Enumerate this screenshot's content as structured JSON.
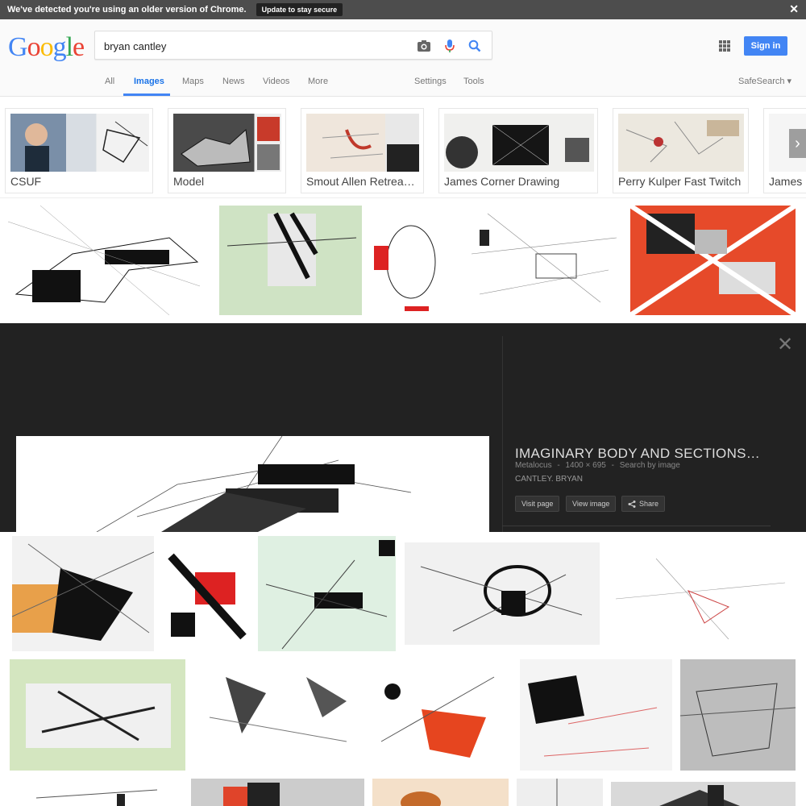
{
  "banner": {
    "message": "We've detected you're using an older version of Chrome.",
    "update_label": "Update to stay secure",
    "close_label": "✕"
  },
  "header": {
    "logo": [
      "G",
      "o",
      "o",
      "g",
      "l",
      "e"
    ],
    "logo_colors": [
      "#4285f4",
      "#ea4335",
      "#fbbc05",
      "#4285f4",
      "#34a853",
      "#ea4335"
    ],
    "search_value": "bryan cantley",
    "signin_label": "Sign in",
    "tabs": [
      "All",
      "Images",
      "Maps",
      "News",
      "Videos",
      "More"
    ],
    "active_tab": "Images",
    "settings_label": "Settings",
    "tools_label": "Tools",
    "safesearch_label": "SafeSearch ▾"
  },
  "chips": [
    {
      "label": "CSUF"
    },
    {
      "label": "Model"
    },
    {
      "label": "Smout Allen Retrea…"
    },
    {
      "label": "James Corner Drawing"
    },
    {
      "label": "Perry Kulper Fast Twitch"
    },
    {
      "label": "James"
    }
  ],
  "chevron_label": "›",
  "preview": {
    "close_label": "✕",
    "title": "IMAGINARY BODY AND SECTIONS…",
    "source": "Metalocus",
    "dimensions": "1400 × 695",
    "search_by_image": "Search by image",
    "description": "CANTLEY. BRYAN",
    "visit_label": "Visit page",
    "view_label": "View image",
    "share_label": "Share",
    "meta_sep": "-"
  },
  "colors": {
    "accent": "#4285f4",
    "panel_bg": "#222222",
    "banner_bg": "#4d4d4d"
  }
}
